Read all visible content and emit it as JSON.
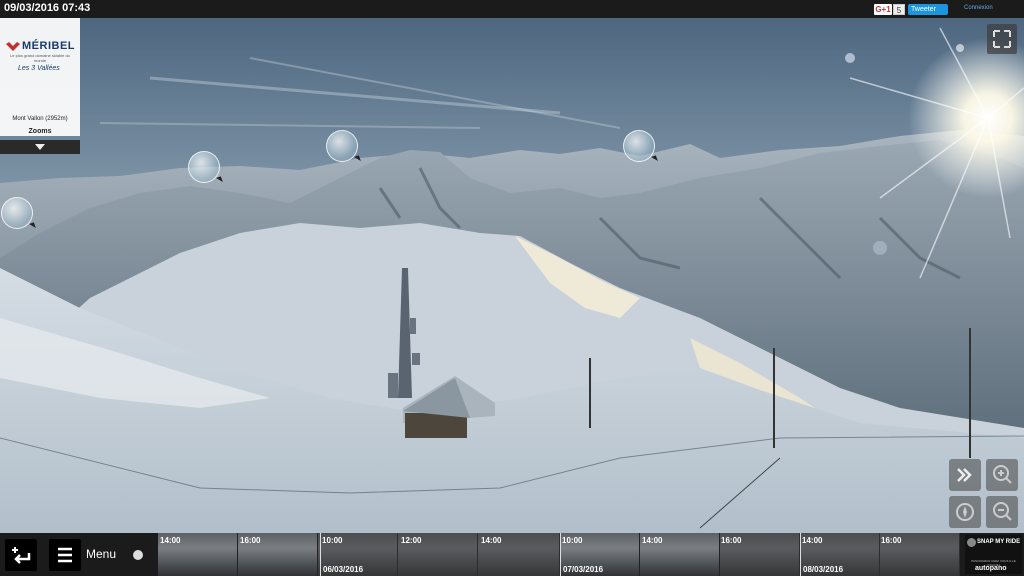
{
  "header": {
    "datetime": "09/03/2016 07:43",
    "gplus_label": "G+1",
    "gplus_count": "5",
    "tweet_label": "Tweeter",
    "login_label": "Connexion"
  },
  "logo": {
    "brand": "MÉRIBEL",
    "tagline": "Le plus grand domaine skiable du monde",
    "valleys": "Les 3 Vallées",
    "location": "Mont Vallon (2952m)",
    "zooms_label": "Zooms"
  },
  "icons": {
    "fullscreen": "fullscreen-icon",
    "bubble": "point-of-interest-icon",
    "fast_forward": "fast-forward-icon",
    "zoom_in": "zoom-in-icon",
    "compass": "compass-icon",
    "zoom_out": "zoom-out-icon",
    "back": "back-arrow-icon",
    "menu": "hamburger-menu-icon"
  },
  "bottom": {
    "menu_label": "Menu",
    "timeline": {
      "times": [
        {
          "label": "14:00"
        },
        {
          "label": "16:00"
        },
        {
          "label": "10:00"
        },
        {
          "label": "12:00"
        },
        {
          "label": "14:00"
        },
        {
          "label": "10:00"
        },
        {
          "label": "14:00"
        },
        {
          "label": "16:00"
        },
        {
          "label": "14:00"
        },
        {
          "label": "16:00"
        }
      ],
      "dates": [
        {
          "label": "06/03/2016"
        },
        {
          "label": "07/03/2016"
        },
        {
          "label": "08/03/2016"
        }
      ]
    },
    "brand": {
      "name": "SNAP MY RIDE",
      "sub": "PANORAMAS CHEZ VOUS & LE LOGICIEL",
      "partner": "autopano"
    }
  },
  "colors": {
    "topbar": "#1b1b1b",
    "twitter": "#1b95e0",
    "brand_blue": "#1b3a6b"
  }
}
